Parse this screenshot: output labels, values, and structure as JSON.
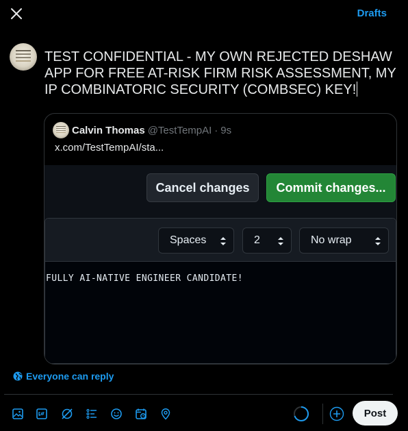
{
  "header": {
    "close_icon": "close-icon",
    "drafts_label": "Drafts"
  },
  "compose": {
    "avatar_icon": "avatar",
    "text": "TEST CONFIDENTIAL - MY OWN REJECTED DESHAW APP FOR FREE AT-RISK FIRM RISK ASSESSMENT, MY IP COMBINATORIC SECURITY (COMBSEC) KEY!"
  },
  "quote": {
    "name": "Calvin Thomas",
    "handle": "@TestTempAI",
    "separator": "·",
    "time": "9s",
    "link_text": "x.com/TestTempAI/sta..."
  },
  "embed": {
    "cancel_label": "Cancel changes",
    "commit_label": "Commit changes...",
    "indent_mode": "Spaces",
    "indent_size": "2",
    "wrap_mode": "No wrap",
    "code_line": "FULLY AI-NATIVE ENGINEER CANDIDATE!"
  },
  "reply_setting": {
    "label": "Everyone can reply",
    "icon": "globe-icon"
  },
  "toolbar": {
    "icons": [
      "image-icon",
      "gif-icon",
      "grok-icon",
      "poll-icon",
      "emoji-icon",
      "schedule-icon",
      "location-icon"
    ],
    "post_label": "Post",
    "add_icon": "plus-circle-icon"
  },
  "colors": {
    "accent": "#1d9bf0",
    "background": "#000000",
    "commit_green": "#238636",
    "github_panel": "#0d1117"
  }
}
